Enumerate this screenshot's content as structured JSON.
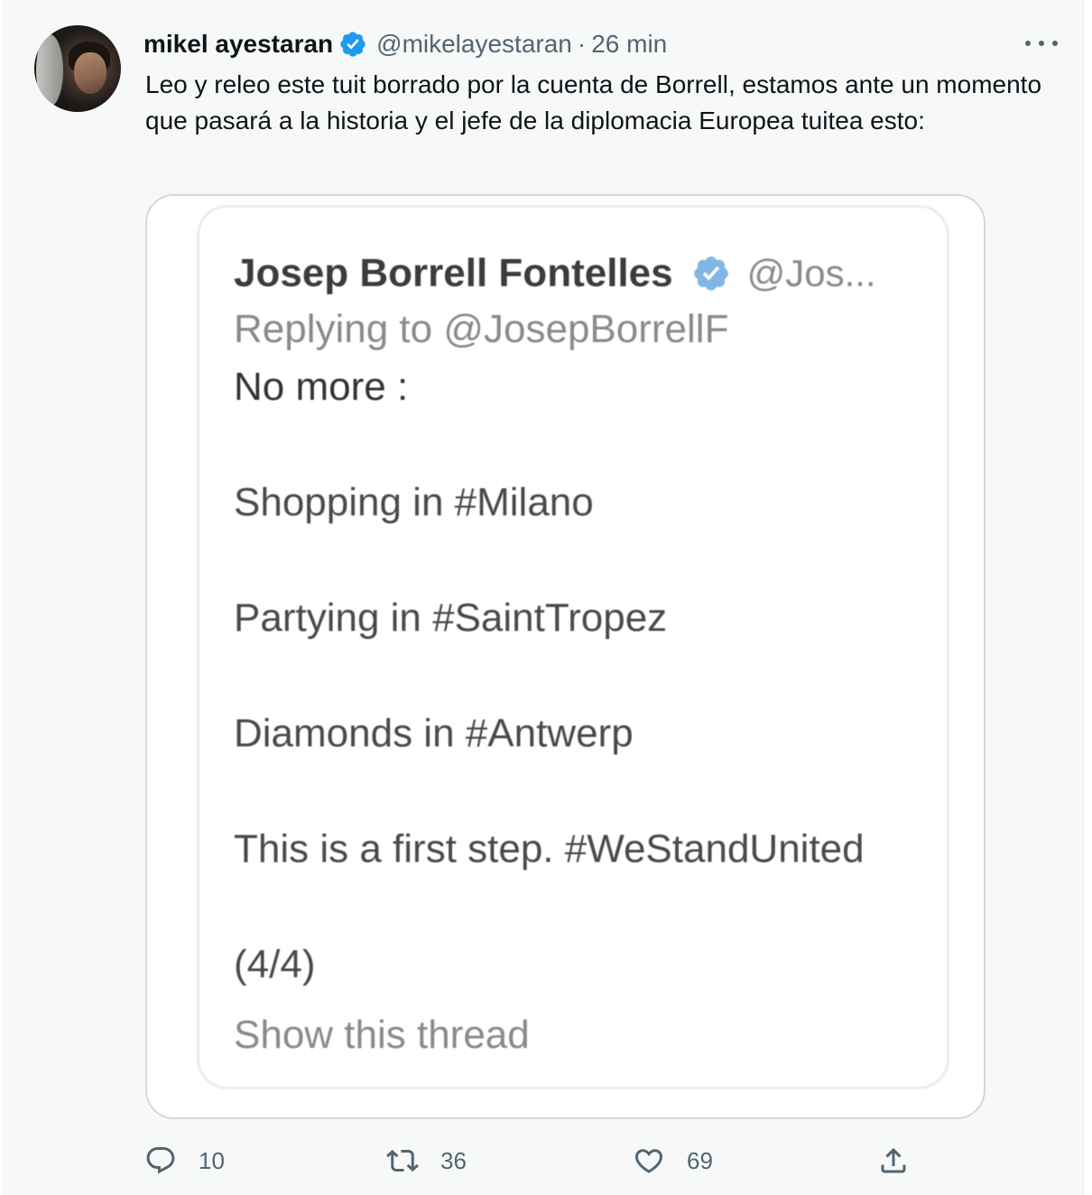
{
  "tweet": {
    "author_name": "mikel ayestaran",
    "author_handle": "@mikelayestaran",
    "separator": "·",
    "time": "26 min",
    "text": "Leo y releo este tuit borrado por la cuenta de Borrell, estamos ante un momento que pasará a la historia y el jefe de la diplomacia Europea tuitea esto:",
    "verified_color": "#1d9bf0"
  },
  "quoted": {
    "author_name": "Josep Borrell Fontelles",
    "author_handle": "@Jos...",
    "replying_to": "Replying to @JosepBorrellF",
    "lines": [
      "No more :",
      "Shopping in #Milano",
      "Partying in #SaintTropez",
      "Diamonds in #Antwerp",
      "This is a first step. #WeStandUnited",
      "(4/4)"
    ],
    "show_thread": "Show this thread"
  },
  "actions": {
    "reply_count": "10",
    "retweet_count": "36",
    "like_count": "69"
  },
  "icons": {
    "more": "more-options-icon",
    "reply": "reply-icon",
    "retweet": "retweet-icon",
    "like": "heart-icon",
    "share": "share-icon"
  }
}
